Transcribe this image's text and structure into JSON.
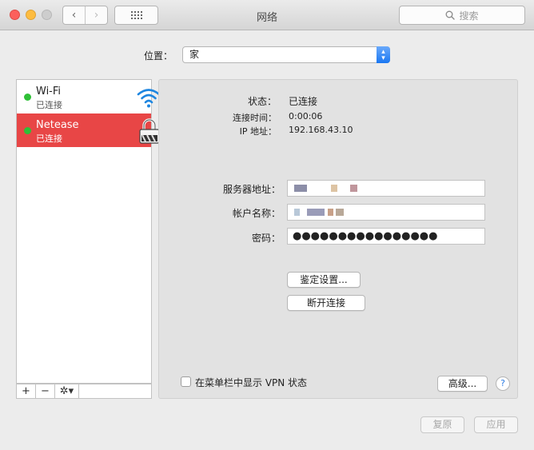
{
  "window": {
    "title": "网络"
  },
  "toolbar": {
    "back_glyph": "‹",
    "forward_glyph": "›",
    "search_placeholder": "搜索"
  },
  "location": {
    "label": "位置：",
    "value": "家"
  },
  "services": [
    {
      "name": "Wi-Fi",
      "status": "已连接",
      "icon": "wifi-icon",
      "selected": false,
      "status_color": "#2fc037"
    },
    {
      "name": "Netease",
      "status": "已连接",
      "icon": "lock-icon",
      "selected": true,
      "status_color": "#2fc037"
    }
  ],
  "list_controls": {
    "add": "+",
    "remove": "−",
    "gear": "✲▾"
  },
  "detail": {
    "status_label": "状态：",
    "status_value": "已连接",
    "connect_time_label": "连接时间：",
    "connect_time_value": "0:00:06",
    "ip_label": "IP 地址：",
    "ip_value": "192.168.43.10",
    "server_label": "服务器地址：",
    "account_label": "帐户名称：",
    "password_label": "密码：",
    "password_value": "●●●●●●●●●●●●●●●●",
    "auth_button": "鉴定设置...",
    "disconnect_button": "断开连接",
    "show_vpn_label": "在菜单栏中显示 VPN 状态",
    "show_vpn_checked": false,
    "advanced_button": "高级...",
    "help": "?"
  },
  "footer": {
    "revert": "复原",
    "apply": "应用"
  },
  "colors": {
    "selected_row": "#e84646",
    "connected_dot": "#2fc037",
    "accent": "#1a77f2"
  }
}
